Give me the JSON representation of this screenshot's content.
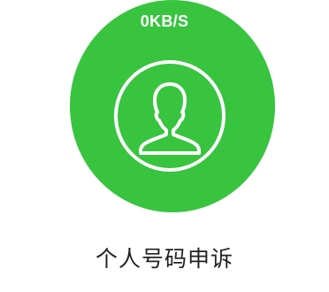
{
  "status": {
    "network_speed": "0KB/S"
  },
  "appeal": {
    "icon": "user-avatar-icon",
    "title": "个人号码申诉"
  },
  "colors": {
    "circle_green": "#38c43f",
    "icon_white": "#ffffff",
    "title_text": "#222222",
    "background": "#ffffff"
  }
}
